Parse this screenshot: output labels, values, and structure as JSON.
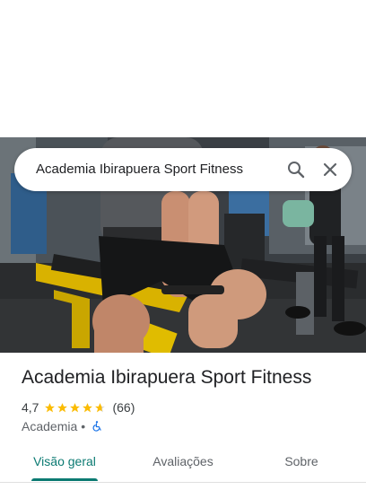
{
  "search": {
    "query": "Academia Ibirapuera Sport Fitness"
  },
  "place": {
    "name": "Academia Ibirapuera Sport Fitness",
    "rating": "4,7",
    "rating_stars": 4.7,
    "review_count": "(66)",
    "category": "Academia",
    "separator": "•"
  },
  "tabs": [
    {
      "label": "Visão geral",
      "active": true
    },
    {
      "label": "Avaliações",
      "active": false
    },
    {
      "label": "Sobre",
      "active": false
    }
  ],
  "colors": {
    "accent": "#0b7a72",
    "star": "#fbbc04",
    "wheelchair": "#1a73e8"
  },
  "icons": {
    "search": "search-icon",
    "close": "close-icon",
    "accessibility": "wheelchair-icon"
  }
}
